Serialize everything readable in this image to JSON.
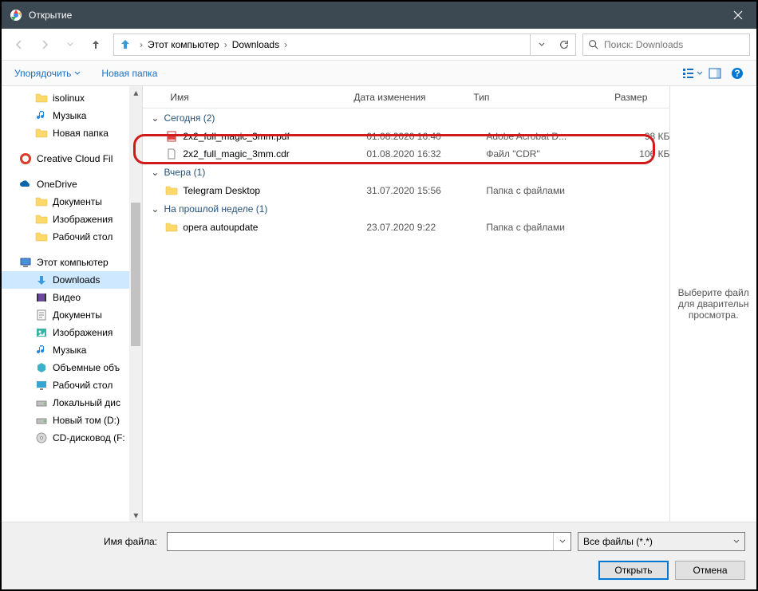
{
  "window": {
    "title": "Открытие"
  },
  "nav": {
    "crumbs": [
      "Этот компьютер",
      "Downloads"
    ],
    "refresh_icon": "refresh"
  },
  "search": {
    "placeholder": "Поиск: Downloads"
  },
  "toolbar": {
    "organize": "Упорядочить",
    "newfolder": "Новая папка"
  },
  "columns": {
    "name": "Имя",
    "date": "Дата изменения",
    "type": "Тип",
    "size": "Размер"
  },
  "sidebar": {
    "items": [
      {
        "label": "isolinux",
        "icon": "folder",
        "indent": true
      },
      {
        "label": "Музыка",
        "icon": "music",
        "indent": true
      },
      {
        "label": "Новая папка",
        "icon": "folder",
        "indent": true
      },
      {
        "label": "Creative Cloud Fil",
        "icon": "cc",
        "indent": false,
        "spacer_before": true
      },
      {
        "label": "OneDrive",
        "icon": "onedrive",
        "indent": false,
        "spacer_before": true
      },
      {
        "label": "Документы",
        "icon": "folder",
        "indent": true
      },
      {
        "label": "Изображения",
        "icon": "folder",
        "indent": true
      },
      {
        "label": "Рабочий стол",
        "icon": "folder",
        "indent": true
      },
      {
        "label": "Этот компьютер",
        "icon": "pc",
        "indent": false,
        "spacer_before": true
      },
      {
        "label": "Downloads",
        "icon": "downloads",
        "indent": true,
        "selected": true
      },
      {
        "label": "Видео",
        "icon": "video",
        "indent": true
      },
      {
        "label": "Документы",
        "icon": "docs",
        "indent": true
      },
      {
        "label": "Изображения",
        "icon": "images",
        "indent": true
      },
      {
        "label": "Музыка",
        "icon": "music2",
        "indent": true
      },
      {
        "label": "Объемные объ",
        "icon": "3d",
        "indent": true
      },
      {
        "label": "Рабочий стол",
        "icon": "desktop",
        "indent": true
      },
      {
        "label": "Локальный дис",
        "icon": "drive",
        "indent": true
      },
      {
        "label": "Новый том (D:)",
        "icon": "drive",
        "indent": true
      },
      {
        "label": "CD-дисковод (F:",
        "icon": "cd",
        "indent": true
      }
    ]
  },
  "groups": [
    {
      "label": "Сегодня (2)",
      "items": [
        {
          "name": "2x2_full_magic_3mm.pdf",
          "date": "01.08.2020 16:40",
          "type": "Adobe Acrobat D...",
          "size": "98 КБ",
          "icon": "pdf"
        },
        {
          "name": "2x2_full_magic_3mm.cdr",
          "date": "01.08.2020 16:32",
          "type": "Файл \"CDR\"",
          "size": "106 КБ",
          "icon": "file",
          "highlighted": true
        }
      ]
    },
    {
      "label": "Вчера (1)",
      "items": [
        {
          "name": "Telegram Desktop",
          "date": "31.07.2020 15:56",
          "type": "Папка с файлами",
          "size": "",
          "icon": "folder"
        }
      ]
    },
    {
      "label": "На прошлой неделе (1)",
      "items": [
        {
          "name": "opera autoupdate",
          "date": "23.07.2020 9:22",
          "type": "Папка с файлами",
          "size": "",
          "icon": "folder"
        }
      ]
    }
  ],
  "preview": {
    "text": "Выберите файл для дварительн просмотра."
  },
  "bottom": {
    "filename_label": "Имя файла:",
    "filename_value": "",
    "filter": "Все файлы (*.*)",
    "open": "Открыть",
    "cancel": "Отмена"
  }
}
